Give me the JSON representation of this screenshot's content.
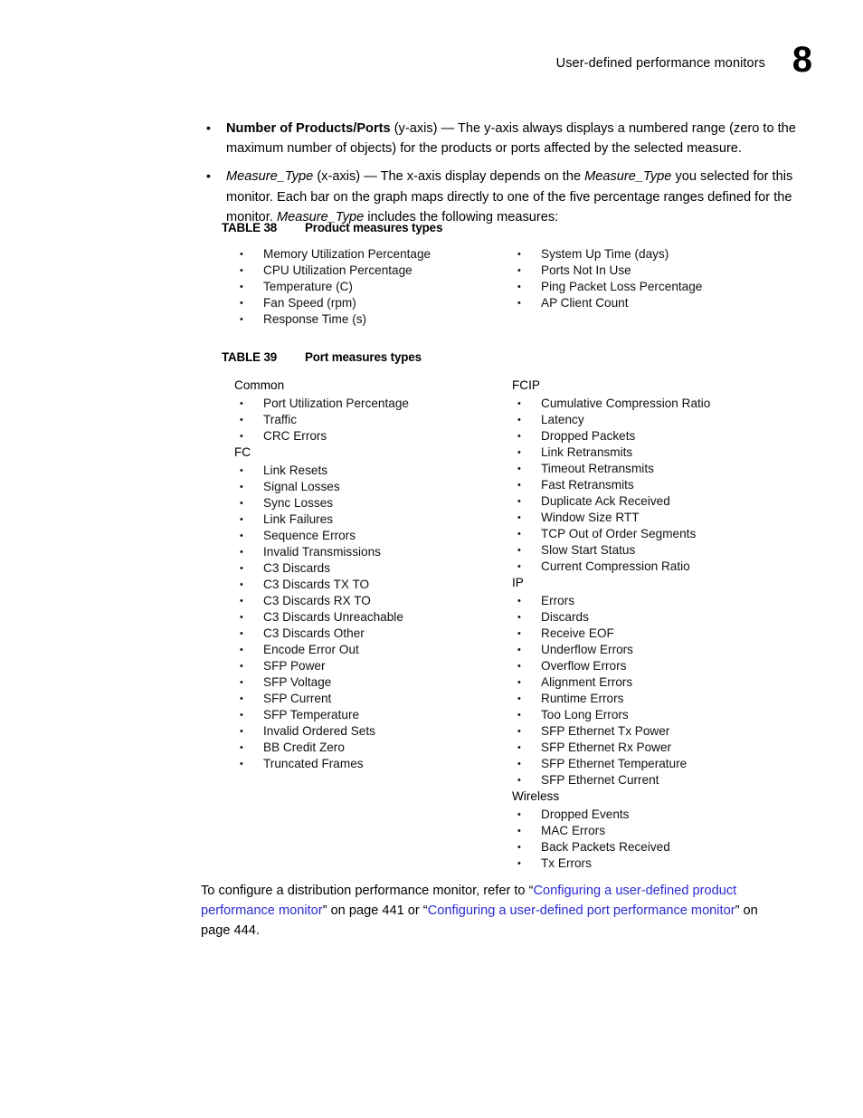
{
  "header": {
    "title": "User-defined performance monitors",
    "chapter_number": "8"
  },
  "intro": {
    "items": [
      {
        "segments": [
          {
            "text": "Number of Products/Ports",
            "style": "bold"
          },
          {
            "text": " (y-axis) — The y-axis always displays a numbered range (zero to the maximum number of objects) for the products or ports affected by the selected measure.",
            "style": "normal"
          }
        ]
      },
      {
        "segments": [
          {
            "text": "Measure_Type",
            "style": "italic"
          },
          {
            "text": " (x-axis) — The x-axis display depends on the ",
            "style": "normal"
          },
          {
            "text": "Measure_Type",
            "style": "italic"
          },
          {
            "text": " you selected for this monitor. Each bar on the graph maps directly to one of the five percentage ranges defined for the monitor. ",
            "style": "normal"
          },
          {
            "text": "Measure_Type",
            "style": "italic"
          },
          {
            "text": " includes the following measures:",
            "style": "normal"
          }
        ]
      }
    ]
  },
  "table38": {
    "caption_number": "TABLE 38",
    "caption_title": "Product measures types",
    "left_column": [
      {
        "group": "",
        "items": [
          "Memory Utilization Percentage",
          "CPU Utilization Percentage",
          "Temperature (C)",
          "Fan Speed (rpm)",
          "Response Time (s)"
        ]
      }
    ],
    "right_column": [
      {
        "group": "",
        "items": [
          "System Up Time (days)",
          "Ports Not In Use",
          "Ping Packet Loss Percentage",
          "AP Client Count"
        ]
      }
    ]
  },
  "table39": {
    "caption_number": "TABLE 39",
    "caption_title": "Port measures types",
    "left_column": [
      {
        "group": "Common",
        "items": [
          "Port Utilization Percentage",
          "Traffic",
          "CRC Errors"
        ]
      },
      {
        "group": "FC",
        "items": [
          "Link Resets",
          "Signal Losses",
          "Sync Losses",
          "Link Failures",
          "Sequence Errors",
          "Invalid Transmissions",
          "C3 Discards",
          "C3 Discards TX TO",
          "C3 Discards RX TO",
          "C3 Discards Unreachable",
          "C3 Discards Other",
          "Encode Error Out",
          "SFP Power",
          "SFP Voltage",
          "SFP Current",
          "SFP Temperature",
          "Invalid Ordered Sets",
          "BB Credit Zero",
          "Truncated Frames"
        ]
      }
    ],
    "right_column": [
      {
        "group": "FCIP",
        "items": [
          "Cumulative Compression Ratio",
          "Latency",
          "Dropped Packets",
          "Link Retransmits",
          "Timeout Retransmits",
          "Fast Retransmits",
          "Duplicate Ack Received",
          "Window Size RTT",
          "TCP Out of Order Segments",
          "Slow Start Status",
          "Current Compression Ratio"
        ]
      },
      {
        "group": "IP",
        "items": [
          "Errors",
          "Discards",
          "Receive EOF",
          "Underflow Errors",
          "Overflow Errors",
          "Alignment Errors",
          "Runtime Errors",
          "Too Long Errors",
          "SFP Ethernet Tx Power",
          "SFP Ethernet Rx Power",
          "SFP Ethernet Temperature",
          "SFP Ethernet Current"
        ]
      },
      {
        "group": "Wireless",
        "items": [
          "Dropped Events",
          "MAC Errors",
          "Back Packets Received",
          "Tx Errors"
        ]
      }
    ]
  },
  "closing": {
    "segments": [
      {
        "text": "To configure a distribution performance monitor, refer to “",
        "style": "normal"
      },
      {
        "text": "Configuring a user-defined product performance monitor",
        "style": "link"
      },
      {
        "text": "” on page 441 or “",
        "style": "normal"
      },
      {
        "text": "Configuring a user-defined port performance monitor",
        "style": "link"
      },
      {
        "text": "” on page 444.",
        "style": "normal"
      }
    ]
  },
  "colors": {
    "link": "#2b2bd4",
    "text": "#000000",
    "background": "#ffffff"
  },
  "icons": {
    "bullet": "•"
  }
}
